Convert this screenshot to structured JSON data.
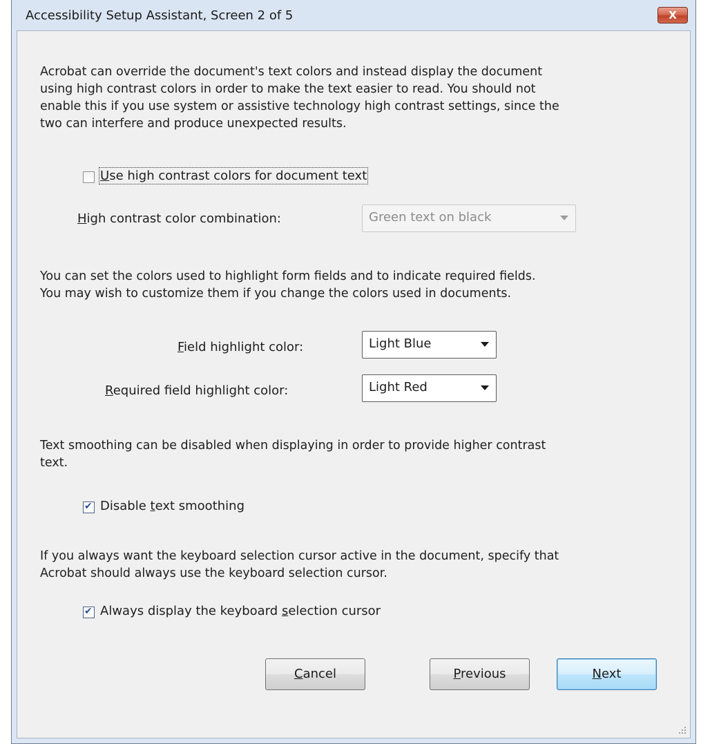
{
  "window": {
    "title": "Accessibility Setup Assistant, Screen 2 of 5",
    "close_label": "X"
  },
  "section_contrast": {
    "lines": [
      "Acrobat can override the document's text colors and instead display the document",
      "using high contrast colors in order to make the text easier to read. You should not",
      "enable this if you use system or assistive technology high contrast settings, since the",
      "two can interfere and produce unexpected results."
    ],
    "checkbox": {
      "label_mnemonic": "U",
      "label_rest": "se high contrast colors for document text",
      "checked": false
    },
    "combo_label_mnemonic": "H",
    "combo_label_rest": "igh contrast color combination:",
    "combo_value": "Green text on black",
    "combo_enabled": false
  },
  "section_forms": {
    "lines": [
      "You can set the colors used to highlight form fields and to indicate required fields.",
      "You may wish to customize them if you change the colors used in documents."
    ],
    "field_label_mnemonic": "F",
    "field_label_rest": "ield highlight color:",
    "field_value": "Light Blue",
    "required_label_mnemonic": "R",
    "required_label_rest": "equired field highlight color:",
    "required_value": "Light Red"
  },
  "section_smoothing": {
    "lines": [
      "Text smoothing can be disabled when displaying in order to provide higher contrast",
      "text."
    ],
    "checkbox": {
      "label_before": "Disable ",
      "label_mnemonic": "t",
      "label_after": "ext smoothing",
      "checked": true
    }
  },
  "section_cursor": {
    "lines": [
      "If you always want the keyboard selection cursor active in the document, specify that",
      "Acrobat should always use the keyboard selection cursor."
    ],
    "checkbox": {
      "label_before": "Always display the keyboard ",
      "label_mnemonic": "s",
      "label_after": "election cursor",
      "checked": true
    }
  },
  "buttons": {
    "cancel_mnemonic": "C",
    "cancel_rest": "ancel",
    "previous_mnemonic": "P",
    "previous_rest": "revious",
    "next_mnemonic": "N",
    "next_rest": "ext"
  },
  "colors": {
    "title_bar": "#dae5f3",
    "client_bg": "#f0f0f0",
    "close_button": "#c9452c",
    "default_button_border": "#3c7fb1",
    "check_mark": "#2a4e9c"
  }
}
